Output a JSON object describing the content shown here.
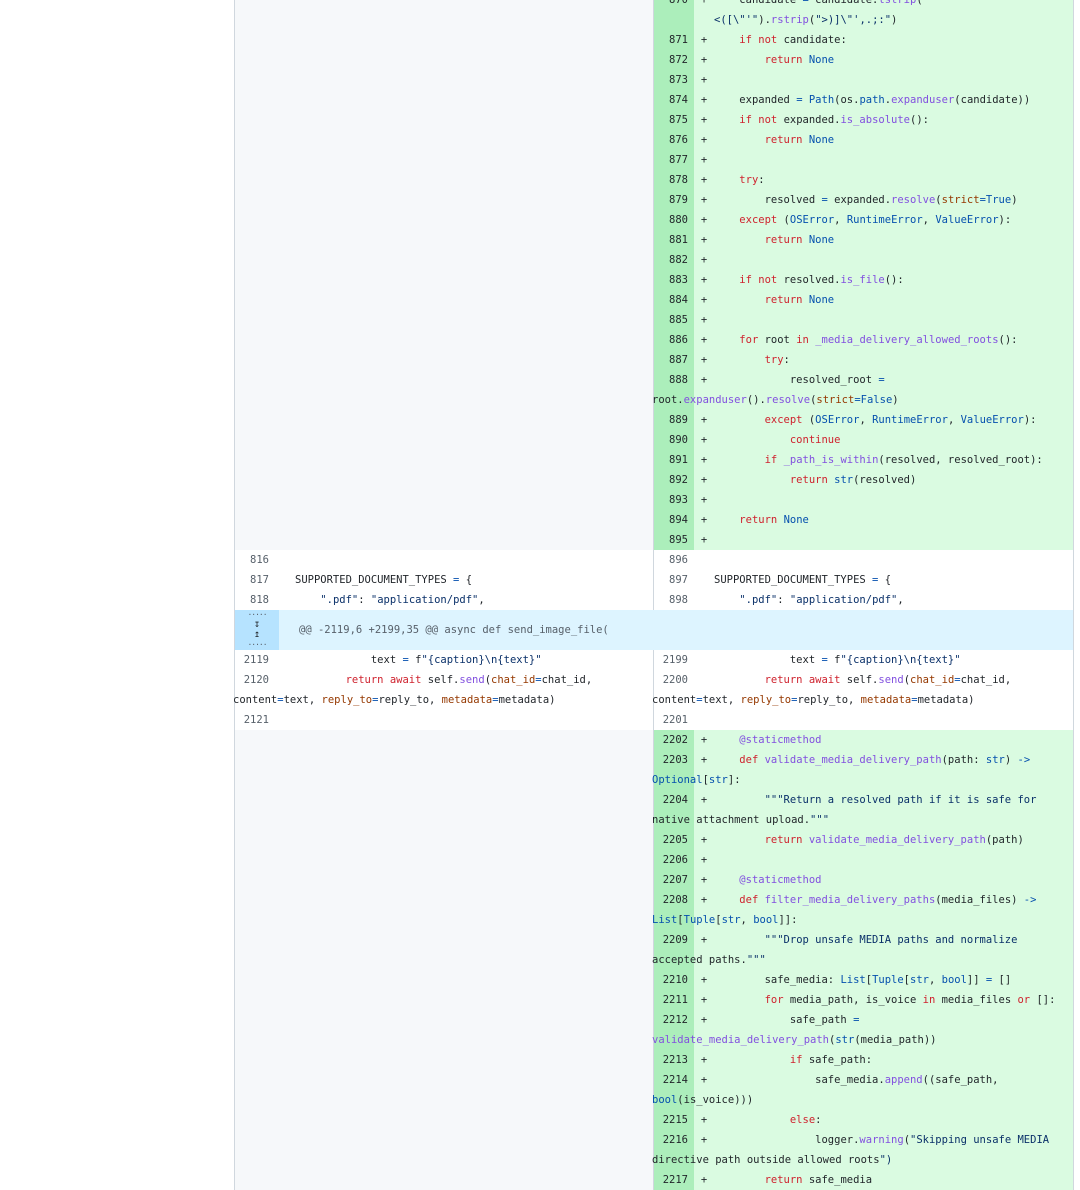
{
  "hunk": {
    "header": "@@ -2119,6 +2199,35 @@ async def send_image_file(",
    "expand_down_icon": "expand-down-icon",
    "expand_up_icon": "expand-up-icon"
  },
  "colors": {
    "addition_bg": "#dafbe1",
    "addition_num_bg": "#aceebb",
    "hunk_bg": "#ddf4ff",
    "hunk_expander_bg": "#b6e3ff",
    "empty_bg": "#f6f8fa"
  },
  "rows": [
    {
      "t": "add",
      "r": "870",
      "code": "    candidate = candidate.lstrip(\"<([\\\"'\").rstrip(\">)]\\\"',.;:\")",
      "wrap": false
    },
    {
      "t": "add",
      "r": "871",
      "code": "    if not candidate:"
    },
    {
      "t": "add",
      "r": "872",
      "code": "        return None"
    },
    {
      "t": "add",
      "r": "873",
      "code": ""
    },
    {
      "t": "add",
      "r": "874",
      "code": "    expanded = Path(os.path.expanduser(candidate))"
    },
    {
      "t": "add",
      "r": "875",
      "code": "    if not expanded.is_absolute():"
    },
    {
      "t": "add",
      "r": "876",
      "code": "        return None"
    },
    {
      "t": "add",
      "r": "877",
      "code": ""
    },
    {
      "t": "add",
      "r": "878",
      "code": "    try:"
    },
    {
      "t": "add",
      "r": "879",
      "code": "        resolved = expanded.resolve(strict=True)"
    },
    {
      "t": "add",
      "r": "880",
      "code": "    except (OSError, RuntimeError, ValueError):"
    },
    {
      "t": "add",
      "r": "881",
      "code": "        return None"
    },
    {
      "t": "add",
      "r": "882",
      "code": ""
    },
    {
      "t": "add",
      "r": "883",
      "code": "    if not resolved.is_file():"
    },
    {
      "t": "add",
      "r": "884",
      "code": "        return None"
    },
    {
      "t": "add",
      "r": "885",
      "code": ""
    },
    {
      "t": "add",
      "r": "886",
      "code": "    for root in _media_delivery_allowed_roots():"
    },
    {
      "t": "add",
      "r": "887",
      "code": "        try:"
    },
    {
      "t": "add",
      "r": "888",
      "code": "            resolved_root =",
      "cont": "root.expanduser().resolve(strict=False)"
    },
    {
      "t": "add",
      "r": "889",
      "code": "        except (OSError, RuntimeError, ValueError):"
    },
    {
      "t": "add",
      "r": "890",
      "code": "            continue"
    },
    {
      "t": "add",
      "r": "891",
      "code": "        if _path_is_within(resolved, resolved_root):"
    },
    {
      "t": "add",
      "r": "892",
      "code": "            return str(resolved)"
    },
    {
      "t": "add",
      "r": "893",
      "code": ""
    },
    {
      "t": "add",
      "r": "894",
      "code": "    return None"
    },
    {
      "t": "add",
      "r": "895",
      "code": ""
    },
    {
      "t": "ctx",
      "l": "816",
      "r": "896",
      "code": ""
    },
    {
      "t": "ctx",
      "l": "817",
      "r": "897",
      "code": "SUPPORTED_DOCUMENT_TYPES = {"
    },
    {
      "t": "ctx",
      "l": "818",
      "r": "898",
      "code": "    \".pdf\": \"application/pdf\","
    },
    {
      "t": "hunk"
    },
    {
      "t": "ctx",
      "l": "2119",
      "r": "2199",
      "code": "            text = f\"{caption}\\n{text}\""
    },
    {
      "t": "ctx",
      "l": "2120",
      "r": "2200",
      "code": "        return await self.send(chat_id=chat_id,",
      "cont": "content=text, reply_to=reply_to, metadata=metadata)"
    },
    {
      "t": "ctx",
      "l": "2121",
      "r": "2201",
      "code": ""
    },
    {
      "t": "add",
      "r": "2202",
      "code": "    @staticmethod"
    },
    {
      "t": "add",
      "r": "2203",
      "code": "    def validate_media_delivery_path(path: str) ->",
      "cont": "Optional[str]:"
    },
    {
      "t": "add",
      "r": "2204",
      "code": "        \"\"\"Return a resolved path if it is safe for",
      "cont": "native attachment upload.\"\"\""
    },
    {
      "t": "add",
      "r": "2205",
      "code": "        return validate_media_delivery_path(path)"
    },
    {
      "t": "add",
      "r": "2206",
      "code": ""
    },
    {
      "t": "add",
      "r": "2207",
      "code": "    @staticmethod"
    },
    {
      "t": "add",
      "r": "2208",
      "code": "    def filter_media_delivery_paths(media_files) ->",
      "cont": "List[Tuple[str, bool]]:"
    },
    {
      "t": "add",
      "r": "2209",
      "code": "        \"\"\"Drop unsafe MEDIA paths and normalize",
      "cont": "accepted paths.\"\"\""
    },
    {
      "t": "add",
      "r": "2210",
      "code": "        safe_media: List[Tuple[str, bool]] = []"
    },
    {
      "t": "add",
      "r": "2211",
      "code": "        for media_path, is_voice in media_files or []:"
    },
    {
      "t": "add",
      "r": "2212",
      "code": "            safe_path =",
      "cont": "validate_media_delivery_path(str(media_path))"
    },
    {
      "t": "add",
      "r": "2213",
      "code": "            if safe_path:"
    },
    {
      "t": "add",
      "r": "2214",
      "code": "                safe_media.append((safe_path,",
      "cont": "bool(is_voice)))"
    },
    {
      "t": "add",
      "r": "2215",
      "code": "            else:"
    },
    {
      "t": "add",
      "r": "2216",
      "code": "                logger.warning(\"Skipping unsafe MEDIA",
      "cont": "directive path outside allowed roots\")"
    },
    {
      "t": "add",
      "r": "2217",
      "code": "        return safe_media"
    }
  ]
}
